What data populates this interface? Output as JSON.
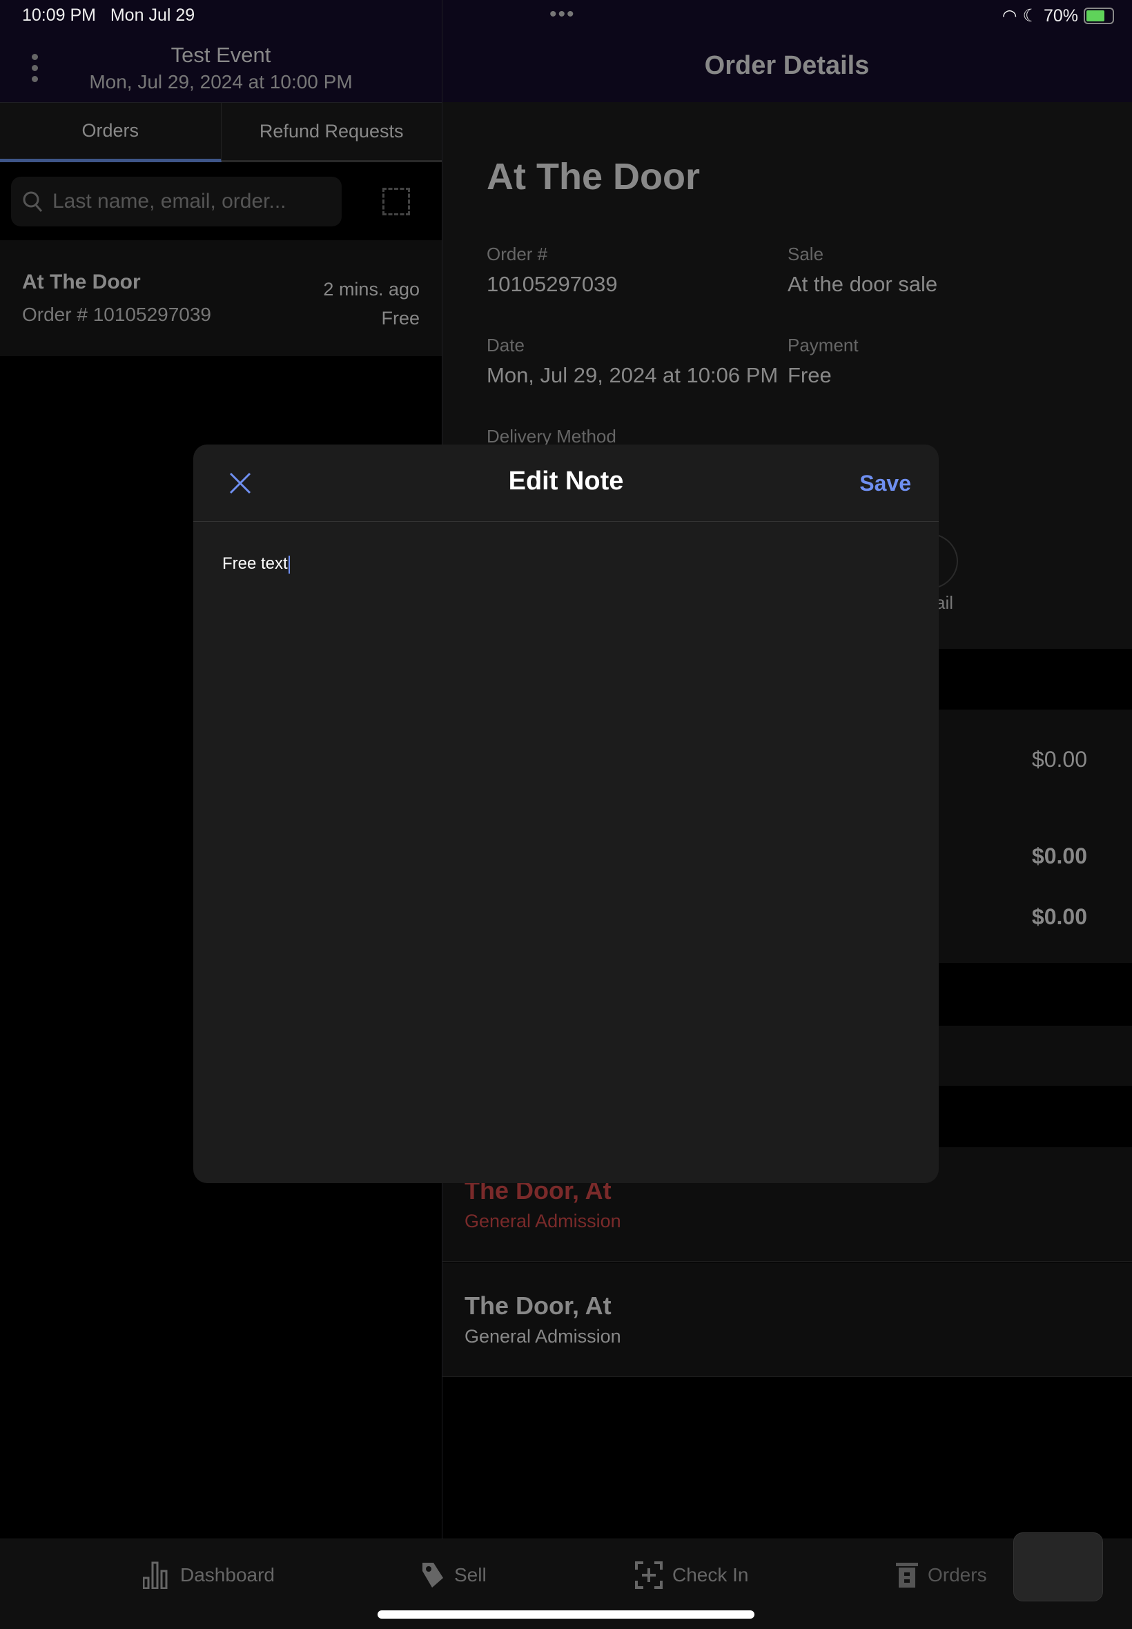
{
  "status_bar": {
    "time": "10:09 PM",
    "date": "Mon Jul 29",
    "battery": "70%"
  },
  "header": {
    "event_title": "Test Event",
    "event_date": "Mon, Jul 29, 2024 at 10:00 PM",
    "right_title": "Order Details"
  },
  "tabs": [
    {
      "label": "Orders"
    },
    {
      "label": "Refund Requests"
    }
  ],
  "search": {
    "placeholder": "Last name, email, order..."
  },
  "orders": [
    {
      "name": "At The Door",
      "order": "Order # 10105297039",
      "time": "2 mins. ago",
      "price": "Free"
    }
  ],
  "details": {
    "title": "At The Door",
    "order_label": "Order #",
    "order_value": "10105297039",
    "sale_label": "Sale",
    "sale_value": "At the door sale",
    "date_label": "Date",
    "date_value": "Mon, Jul 29, 2024 at 10:06 PM",
    "payment_label": "Payment",
    "payment_value": "Free",
    "delivery_label": "Delivery Method",
    "email_partial": "ail",
    "amounts": [
      "$0.00",
      "$0.00",
      "$0.00"
    ],
    "attendees": [
      {
        "name": "The Door, At",
        "ticket": "General Admission"
      },
      {
        "name": "The Door, At",
        "ticket": "General Admission"
      }
    ]
  },
  "modal": {
    "title": "Edit Note",
    "save": "Save",
    "text": "Free text"
  },
  "bottom_nav": [
    {
      "label": "Dashboard",
      "icon": "bar-chart-icon"
    },
    {
      "label": "Sell",
      "icon": "tag-icon"
    },
    {
      "label": "Check In",
      "icon": "scan-icon"
    },
    {
      "label": "Orders",
      "icon": "receipt-icon"
    }
  ],
  "colors": {
    "accent": "#6f8ff0",
    "tab_underline": "#3e5588",
    "attendee_red": "#7a2a2a"
  }
}
